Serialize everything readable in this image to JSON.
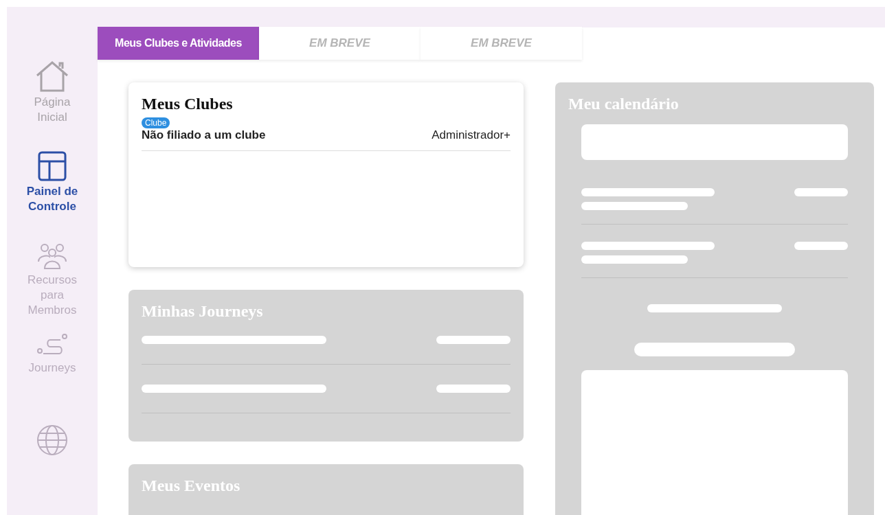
{
  "sidebar": {
    "items": [
      {
        "kind": "house",
        "label": "Página Inicial",
        "selected": false,
        "disabled": false
      },
      {
        "kind": "layout",
        "label": "Painel de Controle",
        "selected": true,
        "disabled": false
      },
      {
        "kind": "people",
        "label": "Recursos para Membros",
        "selected": false,
        "disabled": true
      },
      {
        "kind": "route",
        "label": "Journeys",
        "selected": false,
        "disabled": true
      },
      {
        "kind": "globe",
        "selected": false,
        "disabled": true
      }
    ]
  },
  "tabs": [
    {
      "label": "Meus Clubes e Atividades",
      "selected": true
    },
    {
      "label": "EM BREVE",
      "selected": false
    },
    {
      "label": "EM BREVE",
      "selected": false
    }
  ],
  "clubs_card": {
    "title": "Meus Clubes",
    "rows": [
      {
        "badge": "Clube",
        "name": "Não filiado a um clube",
        "role": "Administrador+"
      }
    ]
  },
  "journeys_card": {
    "title": "Minhas Journeys"
  },
  "events_card": {
    "title": "Meus Eventos"
  },
  "calendar_card": {
    "title": "Meu calendário"
  }
}
